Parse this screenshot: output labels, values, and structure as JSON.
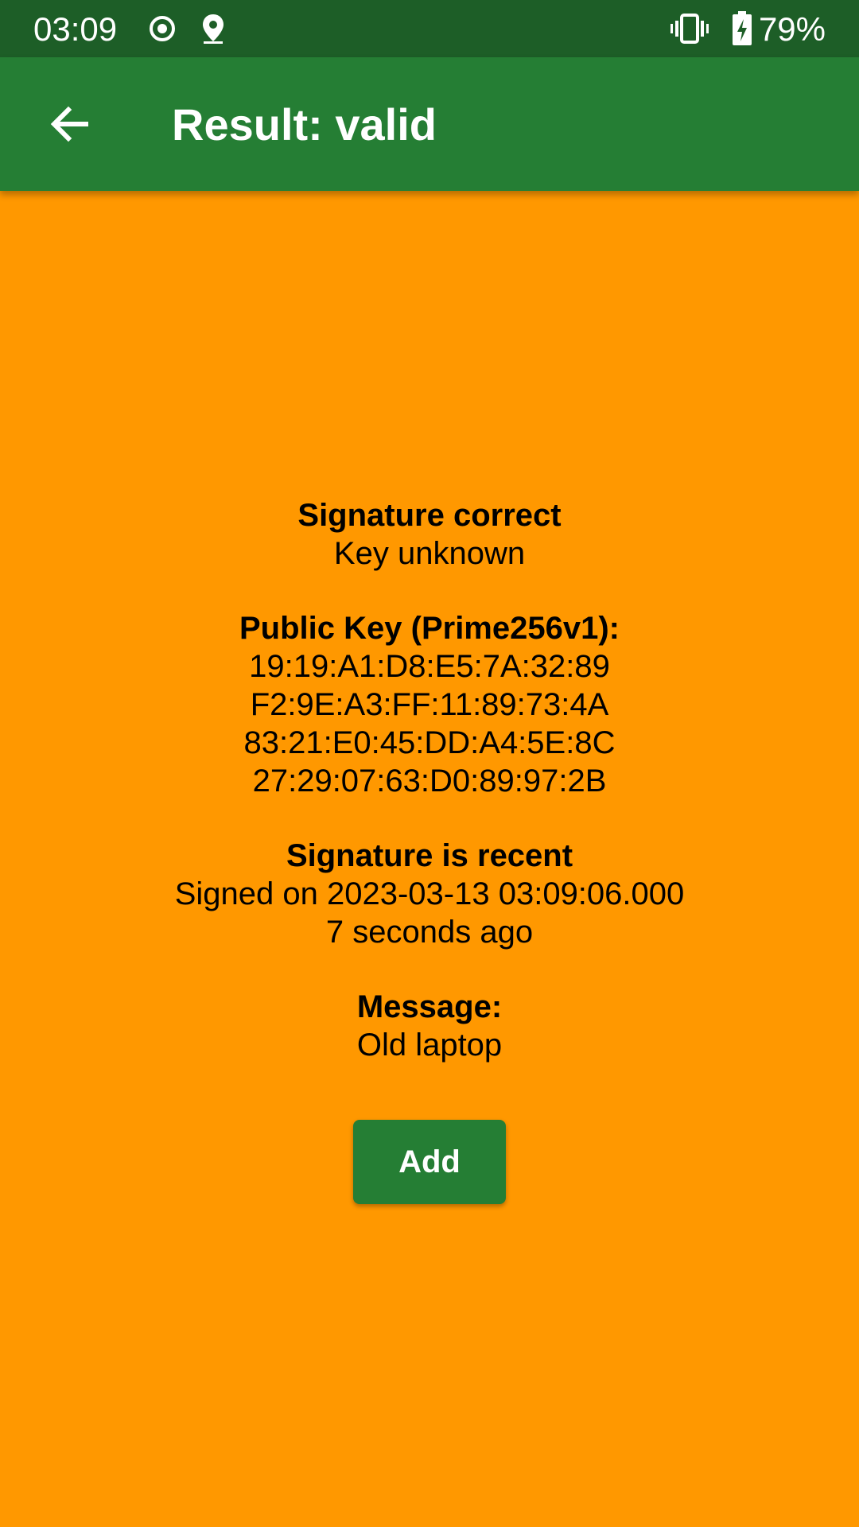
{
  "status_bar": {
    "time": "03:09",
    "battery_percent": "79%",
    "icons": [
      "record-icon",
      "location-icon",
      "vibrate-icon",
      "battery-charging-icon"
    ]
  },
  "app_bar": {
    "title": "Result: valid",
    "back_icon": "arrow-back-icon"
  },
  "result": {
    "signature_heading": "Signature correct",
    "key_status": "Key unknown",
    "public_key_heading": "Public Key (Prime256v1):",
    "public_key_lines": [
      "19:19:A1:D8:E5:7A:32:89",
      "F2:9E:A3:FF:11:89:73:4A",
      "83:21:E0:45:DD:A4:5E:8C",
      "27:29:07:63:D0:89:97:2B"
    ],
    "recency_heading": "Signature is recent",
    "signed_on": "Signed on 2023-03-13 03:09:06.000",
    "age": "7 seconds ago",
    "message_heading": "Message:",
    "message": "Old laptop"
  },
  "actions": {
    "add_label": "Add"
  },
  "colors": {
    "status_bar": "#1d5e27",
    "app_bar": "#257e34",
    "background": "#ff9800",
    "button": "#257e34"
  }
}
